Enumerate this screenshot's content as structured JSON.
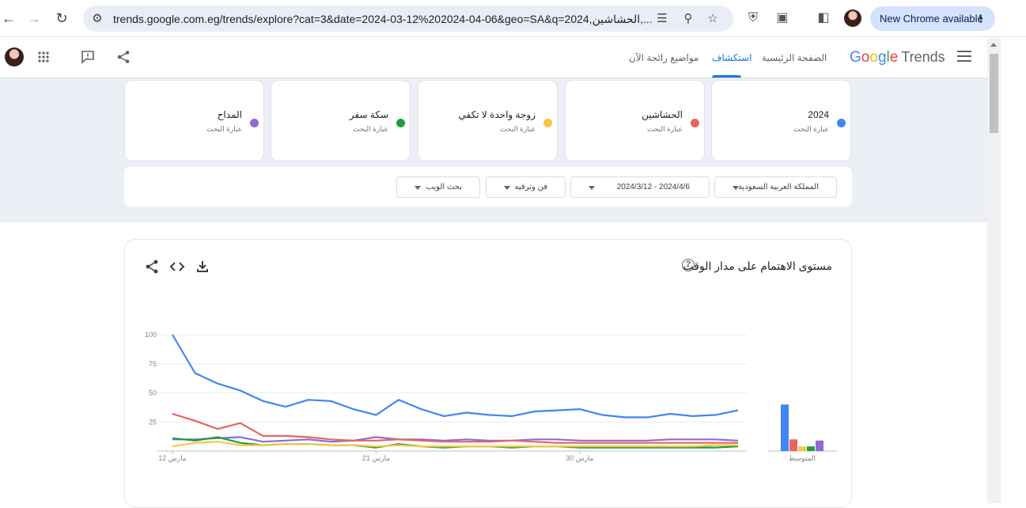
{
  "browser": {
    "url": "trends.google.com.eg/trends/explore?cat=3&date=2024-03-12%202024-04-06&geo=SA&q=2024,الحشاشين,...",
    "new_chrome_label": "New Chrome available"
  },
  "header": {
    "logo_google": "Google",
    "logo_trends": "Trends",
    "tabs": [
      {
        "label": "الصفحة الرئيسية"
      },
      {
        "label": "استكشاف"
      },
      {
        "label": "مواضيع رائجة الآن"
      }
    ]
  },
  "terms": [
    {
      "name": "2024",
      "sub": "عبارة البحث",
      "color": "#4285f4"
    },
    {
      "name": "الحشاشين",
      "sub": "عبارة البحث",
      "color": "#e8645c"
    },
    {
      "name": "زوجة واحدة لا تكفي",
      "sub": "عبارة البحث",
      "color": "#f4c842"
    },
    {
      "name": "سكة سفر",
      "sub": "عبارة البحث",
      "color": "#1e9e3e"
    },
    {
      "name": "المداح",
      "sub": "عبارة البحث",
      "color": "#8e6bd6"
    }
  ],
  "filters": [
    {
      "label": "المملكة العربية السعودية"
    },
    {
      "label": "2024/3/12 - 2024/4/6"
    },
    {
      "label": "فن وترفيه"
    },
    {
      "label": "بحث الويب"
    }
  ],
  "card": {
    "title": "مستوى الاهتمام على مدار الوقت",
    "help": "?"
  },
  "chart_data": {
    "type": "line",
    "x_labels": [
      {
        "label": "12 مارس",
        "index": 0
      },
      {
        "label": "21 مارس",
        "index": 9
      },
      {
        "label": "30 مارس",
        "index": 18
      }
    ],
    "y_ticks": [
      100,
      75,
      50,
      25
    ],
    "ylim": [
      0,
      100
    ],
    "grid": true,
    "series": [
      {
        "name": "2024",
        "color": "#4285f4",
        "values": [
          100,
          67,
          58,
          52,
          43,
          38,
          44,
          43,
          36,
          31,
          44,
          36,
          30,
          33,
          31,
          30,
          34,
          35,
          36,
          31,
          29,
          29,
          32,
          30,
          31,
          35
        ]
      },
      {
        "name": "الحشاشين",
        "color": "#e8645c",
        "values": [
          32,
          26,
          19,
          24,
          13,
          13,
          12,
          10,
          9,
          9,
          10,
          9,
          8,
          8,
          8,
          9,
          8,
          7,
          7,
          7,
          7,
          7,
          7,
          7,
          7,
          7
        ]
      },
      {
        "name": "زوجة واحدة لا تكفي",
        "color": "#f4c842",
        "values": [
          4,
          7,
          8,
          5,
          5,
          6,
          6,
          5,
          5,
          4,
          5,
          4,
          4,
          4,
          4,
          4,
          4,
          4,
          4,
          4,
          4,
          4,
          4,
          4,
          5,
          5
        ]
      },
      {
        "name": "سكة سفر",
        "color": "#1e9e3e",
        "values": [
          11,
          9,
          12,
          7,
          5,
          6,
          6,
          5,
          5,
          3,
          6,
          4,
          3,
          4,
          4,
          3,
          4,
          4,
          3,
          3,
          3,
          3,
          3,
          3,
          3,
          4
        ]
      },
      {
        "name": "المداح",
        "color": "#8e6bd6",
        "values": [
          10,
          10,
          11,
          12,
          8,
          9,
          10,
          8,
          9,
          12,
          10,
          10,
          9,
          10,
          9,
          9,
          10,
          10,
          9,
          9,
          9,
          9,
          10,
          10,
          10,
          9
        ]
      }
    ],
    "averages": {
      "label": "المتوسط",
      "values": [
        40,
        10,
        4,
        4,
        9
      ]
    }
  }
}
